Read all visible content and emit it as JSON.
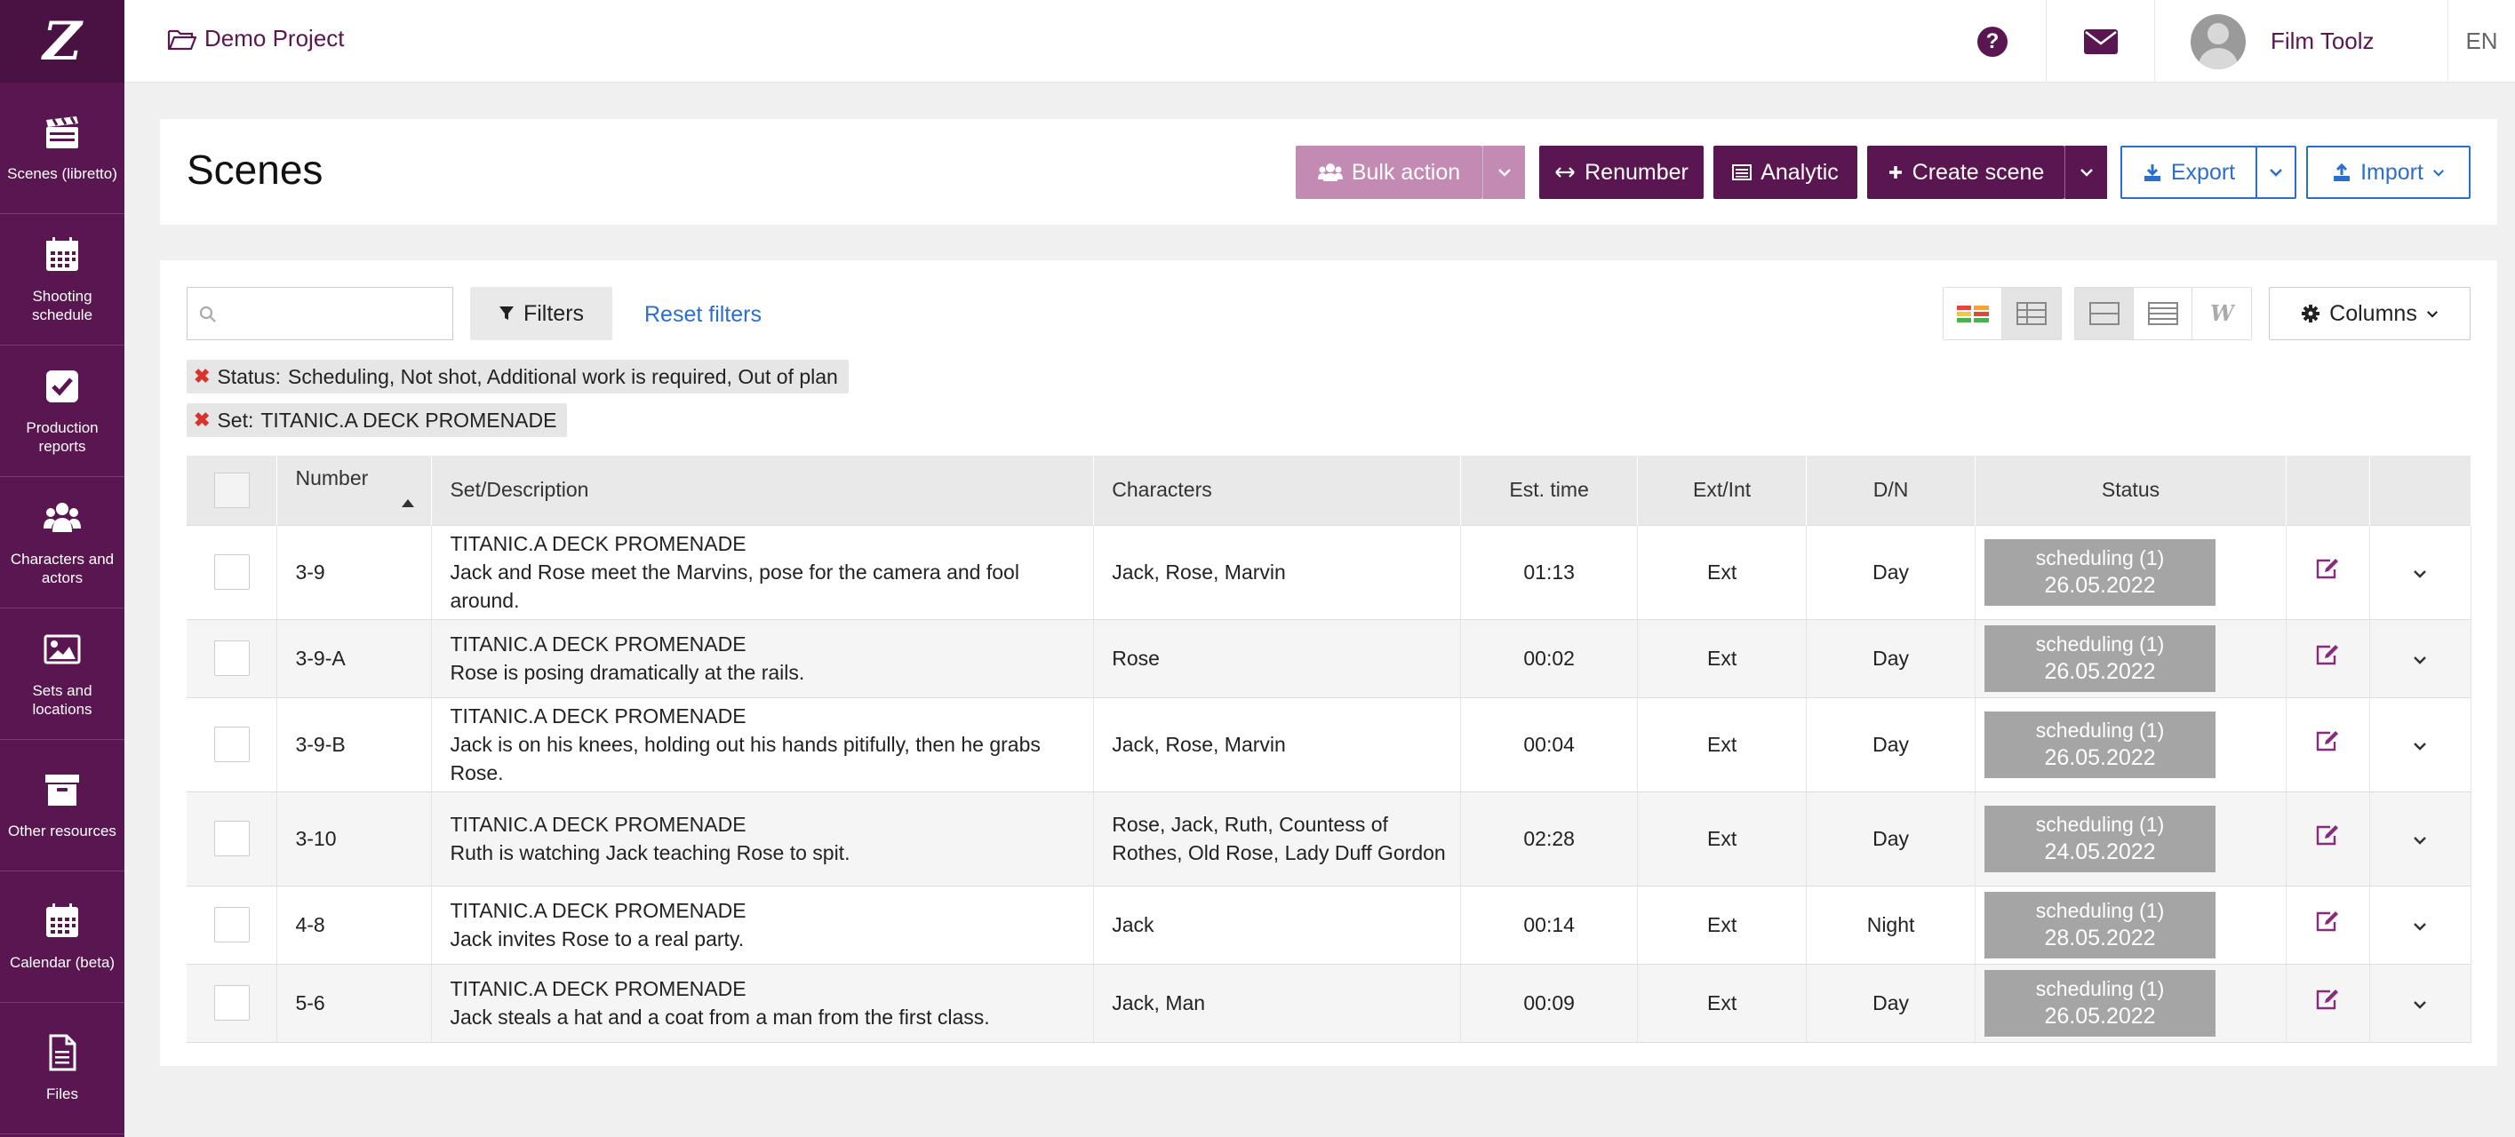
{
  "app": {
    "logo": "Z"
  },
  "sidebar": {
    "items": [
      {
        "label": "Scenes (libretto)",
        "icon": "clapperboard-icon"
      },
      {
        "label": "Shooting schedule",
        "icon": "calendar-icon"
      },
      {
        "label": "Production reports",
        "icon": "checkbox-icon"
      },
      {
        "label": "Characters and actors",
        "icon": "people-icon"
      },
      {
        "label": "Sets and locations",
        "icon": "image-icon"
      },
      {
        "label": "Other resources",
        "icon": "box-icon"
      },
      {
        "label": "Calendar (beta)",
        "icon": "calendar-grid-icon"
      },
      {
        "label": "Files",
        "icon": "file-icon"
      }
    ]
  },
  "topbar": {
    "project": "Demo Project",
    "user_name": "Film Toolz",
    "language": "EN"
  },
  "header": {
    "title": "Scenes",
    "bulk_action": "Bulk action",
    "renumber": "Renumber",
    "analytic": "Analytic",
    "create_scene": "Create scene",
    "export": "Export",
    "import": "Import"
  },
  "toolbar": {
    "search_placeholder": "",
    "filters": "Filters",
    "reset_filters": "Reset filters",
    "columns": "Columns"
  },
  "active_filters": [
    {
      "key": "Status:",
      "value": "Scheduling, Not shot, Additional work is required, Out of plan"
    },
    {
      "key": "Set:",
      "value": "TITANIC.A DECK PROMENADE"
    }
  ],
  "table": {
    "columns": [
      "Number",
      "Set/Description",
      "Characters",
      "Est. time",
      "Ext/Int",
      "D/N",
      "Status"
    ],
    "rows": [
      {
        "number": "3-9",
        "set": "TITANIC.A DECK PROMENADE",
        "desc": "Jack and Rose meet the Marvins, pose for the camera and fool around.",
        "characters": "Jaсk, Rose, Marvin",
        "time": "01:13",
        "ext": "Ext",
        "dn": "Day",
        "status": "scheduling (1)",
        "date": "26.05.2022"
      },
      {
        "number": "3-9-A",
        "set": "TITANIC.A DECK PROMENADE",
        "desc": "Rose is posing dramatically at the rails.",
        "characters": "Rose",
        "time": "00:02",
        "ext": "Ext",
        "dn": "Day",
        "status": "scheduling (1)",
        "date": "26.05.2022"
      },
      {
        "number": "3-9-B",
        "set": "TITANIC.A DECK PROMENADE",
        "desc": "Jack is on his knees, holding out his hands pitifully, then he grabs Rose.",
        "characters": "Jaсk, Rose, Marvin",
        "time": "00:04",
        "ext": "Ext",
        "dn": "Day",
        "status": "scheduling (1)",
        "date": "26.05.2022"
      },
      {
        "number": "3-10",
        "set": "TITANIC.A DECK PROMENADE",
        "desc": "Ruth is watching Jack teaching Rose to spit.",
        "characters": "Rose, Jaсk, Ruth, Countess of Rothes, Old Rose, Lady Duff Gordon",
        "time": "02:28",
        "ext": "Ext",
        "dn": "Day",
        "status": "scheduling (1)",
        "date": "24.05.2022"
      },
      {
        "number": "4-8",
        "set": "TITANIC.A DECK PROMENADE",
        "desc": "Jack invites Rose to a real party.",
        "characters": "Jaсk",
        "time": "00:14",
        "ext": "Ext",
        "dn": "Night",
        "status": "scheduling (1)",
        "date": "28.05.2022"
      },
      {
        "number": "5-6",
        "set": "TITANIC.A DECK PROMENADE",
        "desc": "Jack steals a hat and a coat from a man from the first class.",
        "characters": "Jaсk, Man",
        "time": "00:09",
        "ext": "Ext",
        "dn": "Day",
        "status": "scheduling (1)",
        "date": "26.05.2022"
      }
    ]
  },
  "colors": {
    "brand": "#5a1650",
    "brand_light": "#c38ab3",
    "link": "#2a6fd0",
    "status_badge": "#a5a5a5"
  }
}
